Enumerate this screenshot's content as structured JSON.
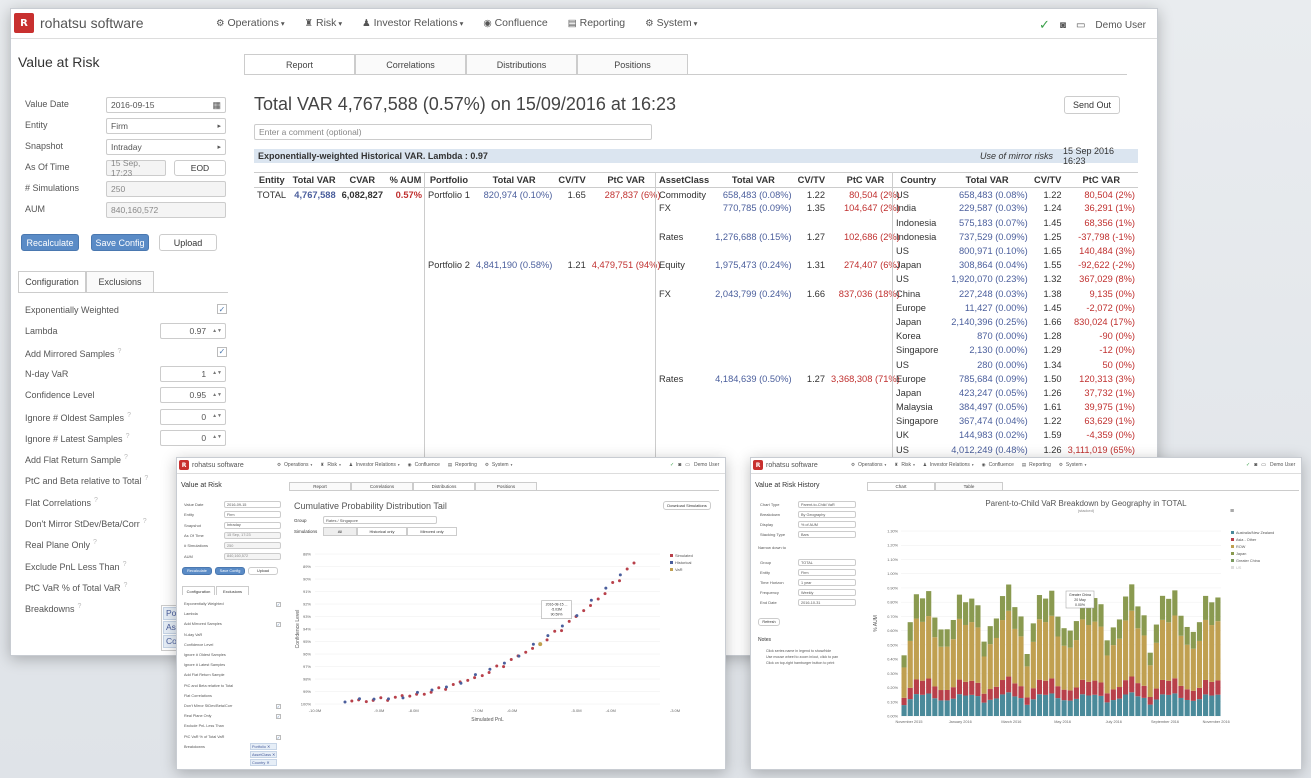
{
  "app": {
    "brand": "rohatsu software",
    "user": "Demo User"
  },
  "menu": [
    "Operations",
    "Risk",
    "Investor Relations",
    "Confluence",
    "Reporting",
    "System"
  ],
  "main": {
    "page_title": "Value at Risk",
    "tabs": [
      "Report",
      "Correlations",
      "Distributions",
      "Positions"
    ],
    "headline": "Total VAR 4,767,588 (0.57%) on 15/09/2016 at 16:23",
    "send_out": "Send Out",
    "comment_placeholder": "Enter a comment (optional)",
    "banner": {
      "left": "Exponentially-weighted Historical VAR. Lambda : 0.97",
      "mirror": "Use of mirror risks",
      "date": "15 Sep 2016 16:23"
    },
    "form": {
      "value_date": {
        "label": "Value Date",
        "value": "2016-09-15"
      },
      "entity": {
        "label": "Entity",
        "value": "Firm"
      },
      "snapshot": {
        "label": "Snapshot",
        "value": "Intraday"
      },
      "as_of": {
        "label": "As Of Time",
        "value": "15 Sep, 17:23",
        "eod": "EOD"
      },
      "sims": {
        "label": "# Simulations",
        "value": "250"
      },
      "aum": {
        "label": "AUM",
        "value": "840,160,572"
      }
    },
    "buttons": {
      "recalc": "Recalculate",
      "save": "Save Config",
      "upload": "Upload"
    },
    "cfg_tabs": [
      "Configuration",
      "Exclusions"
    ],
    "config": [
      {
        "label": "Exponentially Weighted",
        "type": "check",
        "val": "✓"
      },
      {
        "label": "Lambda",
        "type": "num",
        "val": "0.97"
      },
      {
        "label": "Add Mirrored Samples",
        "type": "check",
        "val": "✓",
        "q": "?"
      },
      {
        "label": "N-day VaR",
        "type": "num",
        "val": "1"
      },
      {
        "label": "Confidence Level",
        "type": "num",
        "val": "0.95"
      },
      {
        "label": "Ignore # Oldest Samples",
        "type": "num",
        "val": "0",
        "q": "?"
      },
      {
        "label": "Ignore # Latest Samples",
        "type": "num",
        "val": "0",
        "q": "?"
      },
      {
        "label": "Add Flat Return Sample",
        "type": "none",
        "q": "?"
      },
      {
        "label": "PtC and Beta relative to Total",
        "type": "none",
        "q": "?"
      },
      {
        "label": "Flat Correlations",
        "type": "none",
        "q": "?"
      },
      {
        "label": "Don't Mirror StDev/Beta/Corr",
        "type": "none",
        "q": "?"
      },
      {
        "label": "Real Plane Only",
        "type": "none",
        "q": "?"
      },
      {
        "label": "Exclude PnL Less Than",
        "type": "none",
        "q": "?"
      },
      {
        "label": "PtC VaR % of Total VaR",
        "type": "none",
        "q": "?"
      },
      {
        "label": "Breakdowns",
        "type": "none",
        "q": "?"
      }
    ],
    "breakdown_tags": [
      "Port",
      "Ass",
      "Cou"
    ],
    "table": {
      "h_entity": [
        "Entity",
        "Total VAR",
        "CVAR",
        "% AUM"
      ],
      "h_port": [
        "Portfolio",
        "Total VAR",
        "CV/TV",
        "PtC VAR"
      ],
      "h_asset": [
        "AssetClass",
        "Total VAR",
        "CV/TV",
        "PtC VAR"
      ],
      "h_country": [
        "Country",
        "Total VAR",
        "CV/TV",
        "PtC VAR"
      ],
      "entity": {
        "name": "TOTAL",
        "var": "4,767,588",
        "cvar": "6,082,827",
        "aum": "0.57%"
      },
      "ports": [
        {
          "row": 0,
          "name": "Portfolio 1",
          "var": "820,974 (0.10%)",
          "cv": "1.65",
          "ptc": "287,837 (6%)"
        },
        {
          "row": 5,
          "name": "Portfolio 2",
          "var": "4,841,190 (0.58%)",
          "cv": "1.21",
          "ptc": "4,479,751 (94%)"
        }
      ],
      "assets": [
        {
          "row": 0,
          "name": "Commodity",
          "var": "658,483 (0.08%)",
          "cv": "1.22",
          "ptc": "80,504 (2%)"
        },
        {
          "row": 1,
          "name": "FX",
          "var": "770,785 (0.09%)",
          "cv": "1.35",
          "ptc": "104,647 (2%)"
        },
        {
          "row": 3,
          "name": "Rates",
          "var": "1,276,688 (0.15%)",
          "cv": "1.27",
          "ptc": "102,686 (2%)"
        },
        {
          "row": 5,
          "name": "Equity",
          "var": "1,975,473 (0.24%)",
          "cv": "1.31",
          "ptc": "274,407 (6%)"
        },
        {
          "row": 7,
          "name": "FX",
          "var": "2,043,799 (0.24%)",
          "cv": "1.66",
          "ptc": "837,036 (18%)"
        },
        {
          "row": 13,
          "name": "Rates",
          "var": "4,184,639 (0.50%)",
          "cv": "1.27",
          "ptc": "3,368,308 (71%)"
        }
      ],
      "countries": [
        {
          "name": "US",
          "var": "658,483 (0.08%)",
          "cv": "1.22",
          "ptc": "80,504 (2%)"
        },
        {
          "name": "India",
          "var": "229,587 (0.03%)",
          "cv": "1.24",
          "ptc": "36,291 (1%)"
        },
        {
          "name": "Indonesia",
          "var": "575,183 (0.07%)",
          "cv": "1.45",
          "ptc": "68,356 (1%)"
        },
        {
          "name": "Indonesia",
          "var": "737,529 (0.09%)",
          "cv": "1.25",
          "ptc": "-37,798 (-1%)"
        },
        {
          "name": "US",
          "var": "800,971 (0.10%)",
          "cv": "1.65",
          "ptc": "140,484 (3%)"
        },
        {
          "name": "Japan",
          "var": "308,864 (0.04%)",
          "cv": "1.55",
          "ptc": "-92,622 (-2%)"
        },
        {
          "name": "US",
          "var": "1,920,070 (0.23%)",
          "cv": "1.32",
          "ptc": "367,029 (8%)"
        },
        {
          "name": "China",
          "var": "227,248 (0.03%)",
          "cv": "1.38",
          "ptc": "9,135 (0%)"
        },
        {
          "name": "Europe",
          "var": "11,427 (0.00%)",
          "cv": "1.45",
          "ptc": "-2,072 (0%)"
        },
        {
          "name": "Japan",
          "var": "2,140,396 (0.25%)",
          "cv": "1.66",
          "ptc": "830,024 (17%)"
        },
        {
          "name": "Korea",
          "var": "870 (0.00%)",
          "cv": "1.28",
          "ptc": "-90 (0%)"
        },
        {
          "name": "Singapore",
          "var": "2,130 (0.00%)",
          "cv": "1.29",
          "ptc": "-12 (0%)"
        },
        {
          "name": "US",
          "var": "280 (0.00%)",
          "cv": "1.34",
          "ptc": "50 (0%)"
        },
        {
          "name": "Europe",
          "var": "785,684 (0.09%)",
          "cv": "1.50",
          "ptc": "120,313 (3%)"
        },
        {
          "name": "Japan",
          "var": "423,247 (0.05%)",
          "cv": "1.26",
          "ptc": "37,732 (1%)"
        },
        {
          "name": "Malaysia",
          "var": "384,497 (0.05%)",
          "cv": "1.61",
          "ptc": "39,975 (1%)"
        },
        {
          "name": "Singapore",
          "var": "367,474 (0.04%)",
          "cv": "1.22",
          "ptc": "63,629 (1%)"
        },
        {
          "name": "UK",
          "var": "144,983 (0.02%)",
          "cv": "1.59",
          "ptc": "-4,359 (0%)"
        },
        {
          "name": "US",
          "var": "4,012,249 (0.48%)",
          "cv": "1.26",
          "ptc": "3,111,019 (65%)"
        }
      ]
    }
  },
  "dist": {
    "page_title": "Value at Risk",
    "tabs": [
      "Report",
      "Correlations",
      "Distributions",
      "Positions"
    ],
    "title": "Cumulative Probability Distribution Tail",
    "download": "Download Simulations",
    "group_label": "Group",
    "group_value": "Rates / Singapore",
    "sims_label": "Simulations",
    "sims_opts": [
      "All",
      "Historical only",
      "Mirrored only"
    ],
    "form": [
      "Value Date",
      "Entity",
      "Snapshot",
      "As Of Time",
      "# Simulations",
      "AUM"
    ],
    "form_vals": [
      "2016-09-15",
      "Firm",
      "Intraday",
      "15 Sep, 17:23",
      "250",
      "840,160,572"
    ],
    "buttons": [
      "Recalculate",
      "Save Config",
      "Upload"
    ],
    "cfg_tabs": [
      "Configuration",
      "Exclusions"
    ],
    "config": [
      "Exponentially Weighted",
      "Lambda",
      "Add Mirrored Samples",
      "N-day VaR",
      "Confidence Level",
      "Ignore # Oldest Samples",
      "Ignore # Latest Samples",
      "Add Flat Return Sample",
      "PtC and Beta relative to Total",
      "Flat Correlations",
      "Don't Mirror StDev/Beta/Corr",
      "Real Plane Only",
      "Exclude PnL Less Than",
      "PtC VaR % of Total VaR",
      "Breakdowns"
    ],
    "tags": [
      "Portfolio ✕",
      "AssetClass ✕",
      "Country ✕"
    ],
    "tooltip": [
      "2016-08-15 ...",
      "-5.03M",
      "90.59%"
    ]
  },
  "hist": {
    "page_title": "Value at Risk History",
    "tabs": [
      "Chart",
      "Table"
    ],
    "form": [
      [
        "Chart Type",
        "Parent-to-Child VaR"
      ],
      [
        "Breakdown",
        "By Geography"
      ],
      [
        "Display",
        "% of AUM"
      ],
      [
        "Stacking Type",
        "Bars"
      ]
    ],
    "narrow_label": "Narrow down to",
    "narrow": [
      [
        "Group",
        "TOTAL"
      ],
      [
        "Entity",
        "Firm"
      ],
      [
        "Time Horizon",
        "1 year"
      ],
      [
        "Frequency",
        "Weekly"
      ],
      [
        "End Date",
        "2016-10-31"
      ]
    ],
    "refresh": "Refresh",
    "notes_title": "Notes",
    "notes": [
      "Click series name in legend to show/hide",
      "Use mouse wheel to zoom in/out, click to pan",
      "Click on top-right hamburger button to print"
    ],
    "tooltip": [
      "Greater China",
      "20 May",
      "0.00%"
    ]
  },
  "chart_data": [
    {
      "type": "scatter",
      "title": "Cumulative Probability Distribution Tail",
      "xlabel": "Simulated PnL",
      "ylabel": "Confidence Level",
      "x_ticks": [
        "-10.0M",
        "-9.0M",
        "-8.0M",
        "-7.0M",
        "-6.0M",
        "-5.0M",
        "-4.0M",
        "-3.0M"
      ],
      "y_ticks": [
        "100%",
        "99%",
        "98%",
        "97%",
        "96%",
        "95%",
        "94%",
        "93%",
        "92%",
        "91%",
        "90%",
        "89%",
        "88%"
      ],
      "series": [
        {
          "name": "Simulated"
        },
        {
          "name": "Historical"
        },
        {
          "name": "VaR"
        }
      ]
    },
    {
      "type": "bar",
      "title": "Parent-to-Child VaR Breakdown by Geography in TOTAL",
      "subtitle": "(stacked)",
      "ylabel": "% AUM",
      "y_ticks": [
        "0.00%",
        "0.10%",
        "0.20%",
        "0.30%",
        "0.40%",
        "0.50%",
        "0.60%",
        "0.70%",
        "0.80%",
        "0.90%",
        "1.00%",
        "1.10%",
        "1.20%",
        "1.30%"
      ],
      "x_ticks": [
        "November 2015",
        "January 2016",
        "March 2016",
        "May 2016",
        "July 2016",
        "September 2016",
        "November 2016"
      ],
      "series": [
        {
          "name": "Australia/New Zealand"
        },
        {
          "name": "Asia - Other"
        },
        {
          "name": "ROW"
        },
        {
          "name": "Japan"
        },
        {
          "name": "Greater China"
        },
        {
          "name": "US"
        }
      ]
    }
  ],
  "colors": {
    "brand": "#c8302f",
    "primary": "#5a8bc6",
    "navy": "#4a5e9c",
    "red": "#c0302f",
    "teal": "#4a8a9a",
    "crimson": "#b8404a",
    "olive": "#8a9a50",
    "tan": "#c0a050",
    "green": "#3aa04a"
  }
}
